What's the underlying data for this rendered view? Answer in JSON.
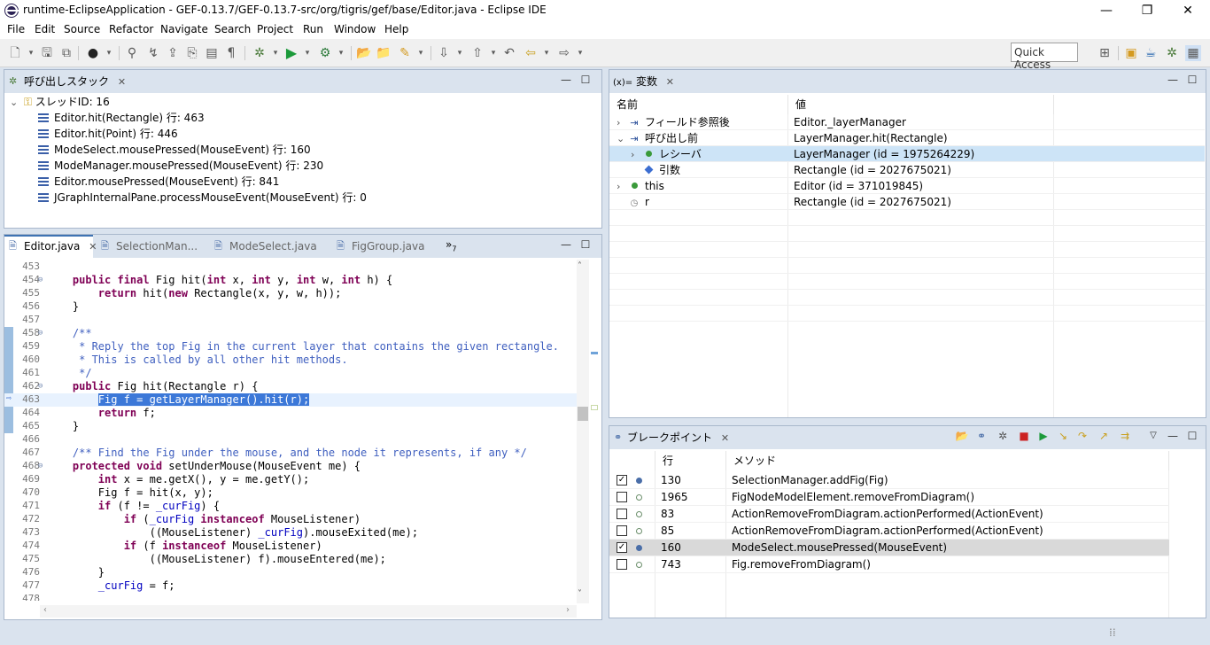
{
  "window": {
    "title": "runtime-EclipseApplication - GEF-0.13.7/GEF-0.13.7-src/org/tigris/gef/base/Editor.java - Eclipse IDE",
    "minimize": "—",
    "restore": "❐",
    "close": "✕"
  },
  "menu": [
    "File",
    "Edit",
    "Source",
    "Refactor",
    "Navigate",
    "Search",
    "Project",
    "Run",
    "Window",
    "Help"
  ],
  "toolbar": {
    "quick_access": "Quick Access"
  },
  "callstack": {
    "tab_label": "呼び出しスタック",
    "thread": "スレッドID: 16",
    "frames": [
      "Editor.hit(Rectangle) 行: 463",
      "Editor.hit(Point) 行: 446",
      "ModeSelect.mousePressed(MouseEvent) 行: 160",
      "ModeManager.mousePressed(MouseEvent) 行: 230",
      "Editor.mousePressed(MouseEvent) 行: 841",
      "JGraphInternalPane.processMouseEvent(MouseEvent) 行: 0"
    ]
  },
  "editor": {
    "tabs": [
      "Editor.java",
      "SelectionMan...",
      "ModeSelect.java",
      "FigGroup.java"
    ],
    "overflow": "»",
    "overflow_count": "7",
    "lines": [
      {
        "n": "453",
        "fold": "",
        "html": ""
      },
      {
        "n": "454",
        "fold": "⊖",
        "html": "    <span class=\"kw\">public final</span> Fig hit(<span class=\"kw\">int</span> x, <span class=\"kw\">int</span> y, <span class=\"kw\">int</span> w, <span class=\"kw\">int</span> h) {"
      },
      {
        "n": "455",
        "fold": "",
        "html": "        <span class=\"kw\">return</span> hit(<span class=\"kw\">new</span> Rectangle(x, y, w, h));"
      },
      {
        "n": "456",
        "fold": "",
        "html": "    }"
      },
      {
        "n": "457",
        "fold": "",
        "html": ""
      },
      {
        "n": "458",
        "fold": "⊖",
        "html": "    <span class=\"jd\">/**</span>"
      },
      {
        "n": "459",
        "fold": "",
        "html": "<span class=\"jd\">     * Reply the top Fig in the current layer that contains the given rectangle.</span>"
      },
      {
        "n": "460",
        "fold": "",
        "html": "<span class=\"jd\">     * This is called by all other hit methods.</span>"
      },
      {
        "n": "461",
        "fold": "",
        "html": "<span class=\"jd\">     */</span>"
      },
      {
        "n": "462",
        "fold": "⊖",
        "html": "    <span class=\"kw\">public</span> Fig hit(Rectangle r) {"
      },
      {
        "n": "463",
        "fold": "",
        "html": "        <span class=\"hl\">Fig f = getLayerManager().hit(r);</span>"
      },
      {
        "n": "464",
        "fold": "",
        "html": "        <span class=\"kw\">return</span> f;"
      },
      {
        "n": "465",
        "fold": "",
        "html": "    }"
      },
      {
        "n": "466",
        "fold": "",
        "html": ""
      },
      {
        "n": "467",
        "fold": "",
        "html": "    <span class=\"jd\">/** Find the Fig under the mouse, and the node it represents, if any */</span>"
      },
      {
        "n": "468",
        "fold": "⊖",
        "html": "    <span class=\"kw\">protected void</span> setUnderMouse(MouseEvent me) {"
      },
      {
        "n": "469",
        "fold": "",
        "html": "        <span class=\"kw\">int</span> x = me.getX(), y = me.getY();"
      },
      {
        "n": "470",
        "fold": "",
        "html": "        Fig f = hit(x, y);"
      },
      {
        "n": "471",
        "fold": "",
        "html": "        <span class=\"kw\">if</span> (f != <span class=\"fld\">_curFig</span>) {"
      },
      {
        "n": "472",
        "fold": "",
        "html": "            <span class=\"kw\">if</span> (<span class=\"fld\">_curFig</span> <span class=\"kw\">instanceof</span> MouseListener)"
      },
      {
        "n": "473",
        "fold": "",
        "html": "                ((MouseListener) <span class=\"fld\">_curFig</span>).mouseExited(me);"
      },
      {
        "n": "474",
        "fold": "",
        "html": "            <span class=\"kw\">if</span> (f <span class=\"kw\">instanceof</span> MouseListener)"
      },
      {
        "n": "475",
        "fold": "",
        "html": "                ((MouseListener) f).mouseEntered(me);"
      },
      {
        "n": "476",
        "fold": "",
        "html": "        }"
      },
      {
        "n": "477",
        "fold": "",
        "html": "        <span class=\"fld\">_curFig</span> = f;"
      },
      {
        "n": "478",
        "fold": "",
        "html": ""
      }
    ]
  },
  "variables": {
    "tab_icon": "(x)=",
    "tab_label": "変数",
    "col_name": "名前",
    "col_value": "値",
    "rows": [
      {
        "chev": "›",
        "icon": "arrow",
        "name": "フィールド参照後",
        "value": "Editor._layerManager",
        "indent": 0
      },
      {
        "chev": "⌄",
        "icon": "arrow",
        "name": "呼び出し前",
        "value": "LayerManager.hit(Rectangle)",
        "indent": 0
      },
      {
        "chev": "›",
        "icon": "gdot",
        "name": "レシーバ",
        "value": "LayerManager (id = 1975264229)",
        "indent": 1
      },
      {
        "chev": "",
        "icon": "diamond",
        "name": "引数",
        "value": "Rectangle (id = 2027675021)",
        "indent": 1
      },
      {
        "chev": "›",
        "icon": "gdot",
        "name": "this",
        "value": "Editor (id = 371019845)",
        "indent": 0
      },
      {
        "chev": "",
        "icon": "local",
        "name": "r",
        "value": "Rectangle (id = 2027675021)",
        "indent": 0
      }
    ]
  },
  "breakpoints": {
    "tab_label": "ブレークポイント",
    "col_line": "行",
    "col_method": "メソッド",
    "rows": [
      {
        "checked": true,
        "line": "130",
        "method": "SelectionManager.addFig(Fig)"
      },
      {
        "checked": false,
        "line": "1965",
        "method": "FigNodeModelElement.removeFromDiagram()"
      },
      {
        "checked": false,
        "line": "83",
        "method": "ActionRemoveFromDiagram.actionPerformed(ActionEvent)"
      },
      {
        "checked": false,
        "line": "85",
        "method": "ActionRemoveFromDiagram.actionPerformed(ActionEvent)"
      },
      {
        "checked": true,
        "line": "160",
        "method": "ModeSelect.mousePressed(MouseEvent)"
      },
      {
        "checked": false,
        "line": "743",
        "method": "Fig.removeFromDiagram()"
      }
    ]
  },
  "colors": {
    "accent": "#3f73b3",
    "keyword": "#7f0055",
    "javadoc": "#3f5fbf",
    "field": "#0000c0",
    "selection": "#3c78d8"
  }
}
